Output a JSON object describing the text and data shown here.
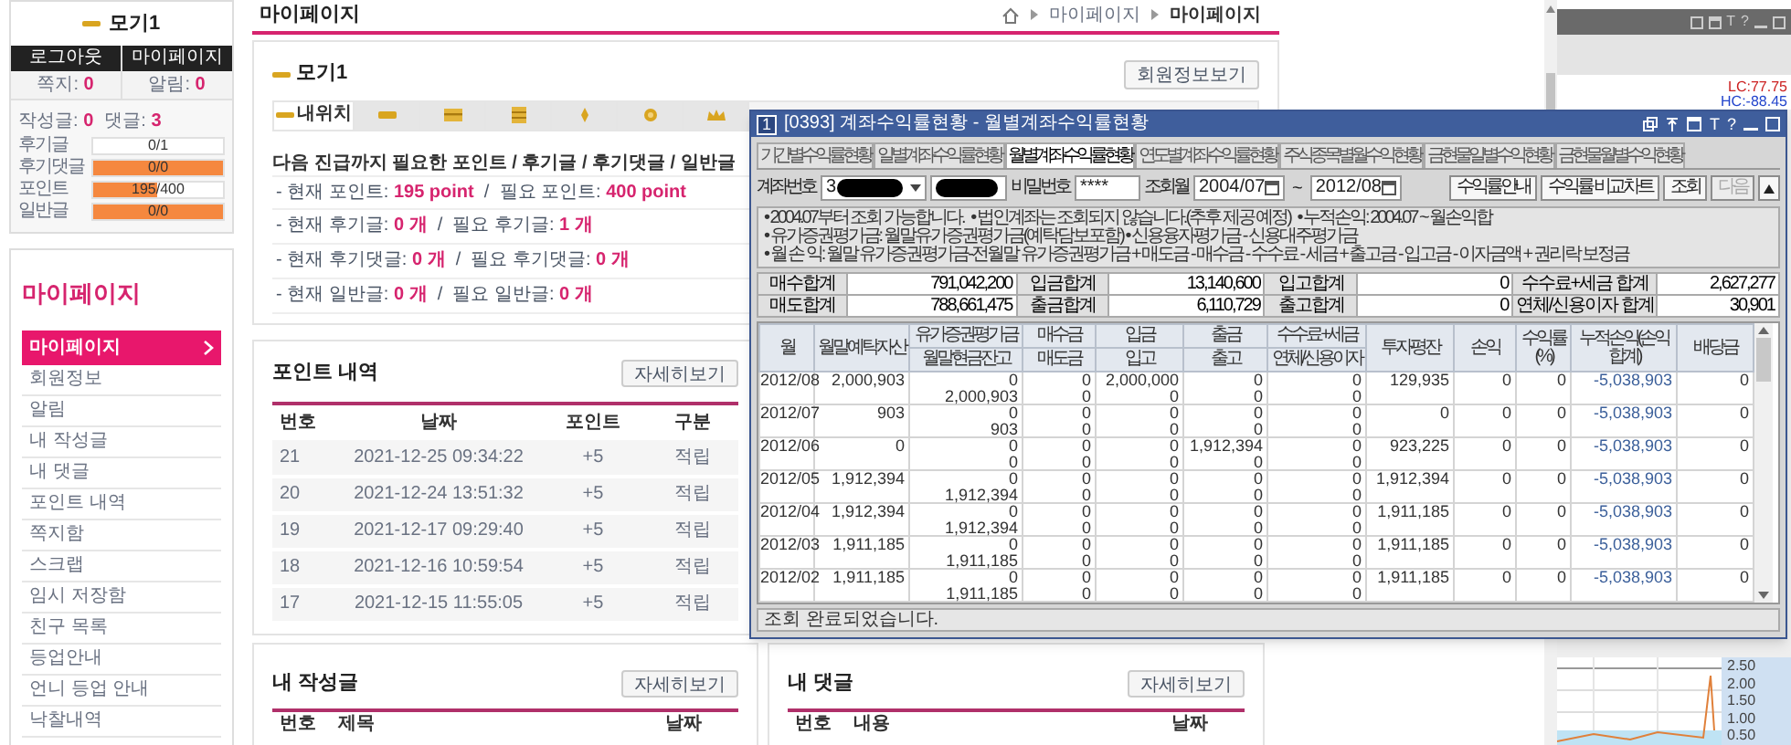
{
  "page": {
    "title": "마이페이지",
    "breadcrumb": [
      "마이페이지",
      "마이페이지"
    ]
  },
  "sidebar": {
    "profile": {
      "name": "모기1",
      "buttons": [
        "로그아웃",
        "마이페이지"
      ],
      "counts": [
        "쪽지: **0**",
        "알림: **0**"
      ],
      "activity": [
        "작성글: **0**",
        "댓글: **3**"
      ],
      "progress": [
        {
          "label": "후기글",
          "reading": "0/1",
          "level": 0
        },
        {
          "label": "후기댓글",
          "reading": "0/0",
          "level": 1
        },
        {
          "label": "포인트",
          "reading": "195/400",
          "level": 0.49
        },
        {
          "label": "일반글",
          "reading": "0/0",
          "level": 1
        }
      ]
    },
    "menu": {
      "title": "마이페이지",
      "items": [
        {
          "label": "마이페이지",
          "selected": true
        },
        {
          "label": "회원정보",
          "selected": false
        },
        {
          "label": "알림",
          "selected": false
        },
        {
          "label": "내 작성글",
          "selected": false
        },
        {
          "label": "내 댓글",
          "selected": false
        },
        {
          "label": "포인트 내역",
          "selected": false
        },
        {
          "label": "쪽지함",
          "selected": false
        },
        {
          "label": "스크랩",
          "selected": false
        },
        {
          "label": "임시 저장함",
          "selected": false
        },
        {
          "label": "친구 목록",
          "selected": false
        },
        {
          "label": "등업안내",
          "selected": false
        },
        {
          "label": "언니 등업 안내",
          "selected": false
        },
        {
          "label": "낙찰내역",
          "selected": false
        }
      ]
    }
  },
  "profile_card": {
    "name": "모기1",
    "button": "회원정보보기",
    "tabs": [
      {
        "label": "내위치",
        "selected": true
      },
      {
        "selected": false
      },
      {
        "selected": false
      },
      {
        "selected": false
      },
      {
        "selected": false
      },
      {
        "selected": false
      },
      {
        "selected": false
      }
    ],
    "heading": "다음 진급까지 필요한 포인트 / 후기글 / 후기댓글 / 일반글",
    "requirements": [
      "- 현재 포인트: **195 point**  /  필요 포인트: **400 point**",
      "- 현재 후기글: **0 개**  /  필요 후기글: **1 개**",
      "- 현재 후기댓글: **0 개**  /  필요 후기댓글: **0 개**",
      "- 현재 일반글: **0 개**  /  필요 일반글: **0 개**"
    ]
  },
  "point_history": {
    "title": "포인트 내역",
    "button": "자세히보기",
    "columns": [
      "번호",
      "날짜",
      "포인트",
      "구분"
    ],
    "rows": [
      [
        "21",
        "2021-12-25 09:34:22",
        "+5",
        "적립"
      ],
      [
        "20",
        "2021-12-24 13:51:32",
        "+5",
        "적립"
      ],
      [
        "19",
        "2021-12-17 09:29:40",
        "+5",
        "적립"
      ],
      [
        "18",
        "2021-12-16 10:59:54",
        "+5",
        "적립"
      ],
      [
        "17",
        "2021-12-15 11:55:05",
        "+5",
        "적립"
      ]
    ]
  },
  "my_posts": {
    "title": "내 작성글",
    "button": "자세히보기",
    "columns": [
      "번호",
      "제목",
      "날짜"
    ]
  },
  "my_comments": {
    "title": "내 댓글",
    "button": "자세히보기",
    "columns": [
      "번호",
      "내용",
      "날짜"
    ]
  },
  "dialog": {
    "badge": "1",
    "title": "[0393] 계좌수익률현황 - 월별계좌수익률현황",
    "title_glyphs": [
      "T",
      "?"
    ],
    "tabs": [
      {
        "label": "기간별수익률현황",
        "selected": false
      },
      {
        "label": "일별계좌수익률현황",
        "selected": false
      },
      {
        "label": "월별계좌수익률현황",
        "selected": true
      },
      {
        "label": "연도별계좌수익률현황",
        "selected": false
      },
      {
        "label": "주식종목별월수익현황",
        "selected": false
      },
      {
        "label": "금현물일별수익현황",
        "selected": false
      },
      {
        "label": "금현물월별수익현황",
        "selected": false
      }
    ],
    "account_label": "계좌번호",
    "account_value": "3",
    "password_label": "비밀번호",
    "password_value": "****",
    "month_label": "조회월",
    "month_from": "2004/07",
    "range_separator": "~",
    "month_to": "2012/08",
    "buttons": [
      {
        "label": "수익률안내",
        "disabled": false
      },
      {
        "label": "수익률 비교차트",
        "disabled": false
      },
      {
        "label": "조회",
        "disabled": false
      },
      {
        "label": "다음",
        "disabled": true
      }
    ],
    "notes": [
      "• 2004.07부터 조회 가능합니다.   • 법인계좌는 조회되지 않습니다.(추후 제공 예정)   • 누적손익: 2004.07 ~ 월손익합",
      "• 유가증권평가금: 월말유가증권평가금(예탁담보포함) • 신용융자평가금 - 신용대주평가금",
      "• 월 손 익: 월말 유가증권평가금-전월말 유가증권평가금 + 매도금 - 매수금 - 수수료 - 세금 + 출고금 - 입고금 - 이자금액 + 권리락 보정금"
    ],
    "summary": [
      [
        "매수합계",
        "791,042,200",
        "입금합계",
        "13,140,600",
        "입고합계",
        "0",
        "수수료+세금 합계",
        "2,627,277"
      ],
      [
        "매도합계",
        "788,661,475",
        "출금합계",
        "6,110,729",
        "출고합계",
        "0",
        "연체/신용이자 합계",
        "30,901"
      ]
    ],
    "columns": [
      {
        "top": "월"
      },
      {
        "top": "월말예탁자산"
      },
      {
        "top": "유가증권평가금",
        "bottom": "월말현금잔고"
      },
      {
        "top": "매수금",
        "bottom": "매도금"
      },
      {
        "top": "입금",
        "bottom": "입고"
      },
      {
        "top": "출금",
        "bottom": "출고"
      },
      {
        "top": "수수료+세금",
        "bottom": "연체/신용이자"
      },
      {
        "top": "투자평잔"
      },
      {
        "top": "손익"
      },
      {
        "top": "수익률(%)"
      },
      {
        "top": "누적손익(손익합계)"
      },
      {
        "top": "배당금"
      }
    ],
    "rows": [
      [
        [
          "2012/08"
        ],
        [
          "2,000,903"
        ],
        [
          "0",
          "2,000,903"
        ],
        [
          "0",
          "0"
        ],
        [
          "2,000,000",
          "0"
        ],
        [
          "0",
          "0"
        ],
        [
          "0",
          "0"
        ],
        [
          "129,935"
        ],
        [
          "0"
        ],
        [
          "0"
        ],
        [
          "-5,038,903"
        ],
        [
          "0"
        ]
      ],
      [
        [
          "2012/07"
        ],
        [
          "903"
        ],
        [
          "0",
          "903"
        ],
        [
          "0",
          "0"
        ],
        [
          "0",
          "0"
        ],
        [
          "0",
          "0"
        ],
        [
          "0",
          "0"
        ],
        [
          "0"
        ],
        [
          "0"
        ],
        [
          "0"
        ],
        [
          "-5,038,903"
        ],
        [
          "0"
        ]
      ],
      [
        [
          "2012/06"
        ],
        [
          "0"
        ],
        [
          "0",
          "0"
        ],
        [
          "0",
          "0"
        ],
        [
          "0",
          "0"
        ],
        [
          "1,912,394",
          "0"
        ],
        [
          "0",
          "0"
        ],
        [
          "923,225"
        ],
        [
          "0"
        ],
        [
          "0"
        ],
        [
          "-5,038,903"
        ],
        [
          "0"
        ]
      ],
      [
        [
          "2012/05"
        ],
        [
          "1,912,394"
        ],
        [
          "0",
          "1,912,394"
        ],
        [
          "0",
          "0"
        ],
        [
          "0",
          "0"
        ],
        [
          "0",
          "0"
        ],
        [
          "0",
          "0"
        ],
        [
          "1,912,394"
        ],
        [
          "0"
        ],
        [
          "0"
        ],
        [
          "-5,038,903"
        ],
        [
          "0"
        ]
      ],
      [
        [
          "2012/04"
        ],
        [
          "1,912,394"
        ],
        [
          "0",
          "1,912,394"
        ],
        [
          "0",
          "0"
        ],
        [
          "0",
          "0"
        ],
        [
          "0",
          "0"
        ],
        [
          "0",
          "0"
        ],
        [
          "1,911,185"
        ],
        [
          "0"
        ],
        [
          "0"
        ],
        [
          "-5,038,903"
        ],
        [
          "0"
        ]
      ],
      [
        [
          "2012/03"
        ],
        [
          "1,911,185"
        ],
        [
          "0",
          "1,911,185"
        ],
        [
          "0",
          "0"
        ],
        [
          "0",
          "0"
        ],
        [
          "0",
          "0"
        ],
        [
          "0",
          "0"
        ],
        [
          "1,911,185"
        ],
        [
          "0"
        ],
        [
          "0"
        ],
        [
          "-5,038,903"
        ],
        [
          "0"
        ]
      ],
      [
        [
          "2012/02"
        ],
        [
          "1,911,185"
        ],
        [
          "0",
          "1,911,185"
        ],
        [
          "0",
          "0"
        ],
        [
          "0",
          "0"
        ],
        [
          "0",
          "0"
        ],
        [
          "0",
          "0"
        ],
        [
          "1,911,185"
        ],
        [
          "0"
        ],
        [
          "0"
        ],
        [
          "-5,038,903"
        ],
        [
          "0"
        ]
      ]
    ],
    "status": "조회 완료되었습니다."
  },
  "side_app": {
    "toolbar_glyphs": [
      "T",
      "?"
    ],
    "indicators": [
      "LC:77.75",
      "HC:-88.45"
    ],
    "axis_labels": [
      "2.50",
      "2.00",
      "1.50",
      "1.00",
      "0.50"
    ]
  }
}
